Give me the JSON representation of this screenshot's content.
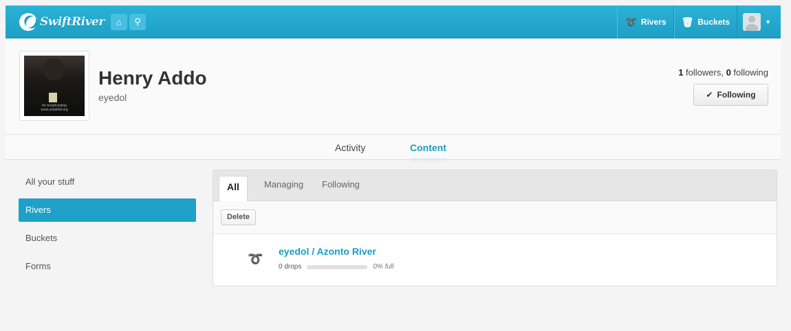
{
  "topbar": {
    "logo_text_a": "Swift",
    "logo_text_b": "River",
    "nav": [
      {
        "label": "Rivers",
        "icon": "river-icon"
      },
      {
        "label": "Buckets",
        "icon": "bucket-icon"
      }
    ],
    "brand_color": "#1fa0c8"
  },
  "profile": {
    "name": "Henry Addo",
    "handle": "eyedol",
    "followers": "1",
    "followers_label": " followers, ",
    "following": "0",
    "following_label": " following",
    "follow_button": "Following",
    "photo_caption": "for broadcasting www.ushahidi.org"
  },
  "profile_tabs": [
    "Activity",
    "Content"
  ],
  "sidebar": {
    "items": [
      "All your stuff",
      "Rivers",
      "Buckets",
      "Forms"
    ],
    "active_index": 1
  },
  "content": {
    "tabs": [
      "All",
      "Managing",
      "Following"
    ],
    "delete_label": "Delete",
    "rivers": [
      {
        "title": "eyedol / Azonto River",
        "drops": "0 drops",
        "fill_percent": 0,
        "full_label": "0% full"
      }
    ]
  }
}
